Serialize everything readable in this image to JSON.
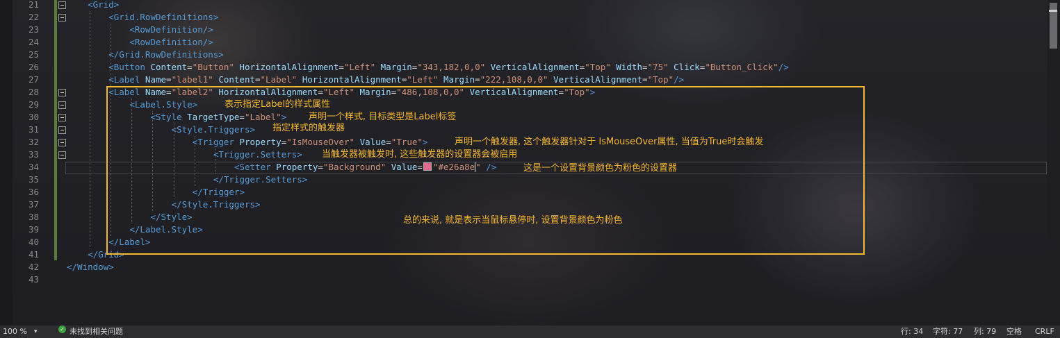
{
  "editor": {
    "lines": [
      {
        "n": "21",
        "segs": [
          [
            "tag",
            "<Grid"
          ],
          [
            "tag",
            ">"
          ]
        ]
      },
      {
        "n": "22",
        "segs": [
          [
            "tag",
            "<Grid.RowDefinitions"
          ],
          [
            "tag",
            ">"
          ]
        ]
      },
      {
        "n": "23",
        "segs": [
          [
            "tag",
            "<RowDefinition"
          ],
          [
            "tag",
            "/>"
          ]
        ]
      },
      {
        "n": "24",
        "segs": [
          [
            "tag",
            "<RowDefinition"
          ],
          [
            "tag",
            "/>"
          ]
        ]
      },
      {
        "n": "25",
        "segs": [
          [
            "tag",
            "</Grid.RowDefinitions"
          ],
          [
            "tag",
            ">"
          ]
        ]
      },
      {
        "n": "26",
        "segs": [
          [
            "tag",
            "<Button"
          ],
          [
            "t",
            " "
          ],
          [
            "attr",
            "Content"
          ],
          [
            "eq",
            "="
          ],
          [
            "str",
            "\"Button\""
          ],
          [
            "t",
            " "
          ],
          [
            "attr",
            "HorizontalAlignment"
          ],
          [
            "eq",
            "="
          ],
          [
            "str",
            "\"Left\""
          ],
          [
            "t",
            " "
          ],
          [
            "attr",
            "Margin"
          ],
          [
            "eq",
            "="
          ],
          [
            "str",
            "\"343,182,0,0\""
          ],
          [
            "t",
            " "
          ],
          [
            "attr",
            "VerticalAlignment"
          ],
          [
            "eq",
            "="
          ],
          [
            "str",
            "\"Top\""
          ],
          [
            "t",
            " "
          ],
          [
            "attr",
            "Width"
          ],
          [
            "eq",
            "="
          ],
          [
            "str",
            "\"75\""
          ],
          [
            "t",
            " "
          ],
          [
            "attr",
            "Click"
          ],
          [
            "eq",
            "="
          ],
          [
            "str",
            "\"Button_Click\""
          ],
          [
            "tag",
            "/>"
          ]
        ]
      },
      {
        "n": "27",
        "segs": [
          [
            "tag",
            "<Label"
          ],
          [
            "t",
            " "
          ],
          [
            "attr",
            "Name"
          ],
          [
            "eq",
            "="
          ],
          [
            "str",
            "\"label1\""
          ],
          [
            "t",
            " "
          ],
          [
            "attr",
            "Content"
          ],
          [
            "eq",
            "="
          ],
          [
            "str",
            "\"Label\""
          ],
          [
            "t",
            " "
          ],
          [
            "attr",
            "HorizontalAlignment"
          ],
          [
            "eq",
            "="
          ],
          [
            "str",
            "\"Left\""
          ],
          [
            "t",
            " "
          ],
          [
            "attr",
            "Margin"
          ],
          [
            "eq",
            "="
          ],
          [
            "str",
            "\"222,108,0,0\""
          ],
          [
            "t",
            " "
          ],
          [
            "attr",
            "VerticalAlignment"
          ],
          [
            "eq",
            "="
          ],
          [
            "str",
            "\"Top\""
          ],
          [
            "tag",
            "/>"
          ]
        ]
      },
      {
        "n": "28",
        "segs": [
          [
            "tag",
            "<Label"
          ],
          [
            "t",
            " "
          ],
          [
            "attr",
            "Name"
          ],
          [
            "eq",
            "="
          ],
          [
            "str",
            "\"label2\""
          ],
          [
            "t",
            " "
          ],
          [
            "attr",
            "HorizontalAlignment"
          ],
          [
            "eq",
            "="
          ],
          [
            "str",
            "\"Left\""
          ],
          [
            "t",
            " "
          ],
          [
            "attr",
            "Margin"
          ],
          [
            "eq",
            "="
          ],
          [
            "str",
            "\"486,108,0,0\""
          ],
          [
            "t",
            " "
          ],
          [
            "attr",
            "VerticalAlignment"
          ],
          [
            "eq",
            "="
          ],
          [
            "str",
            "\"Top\""
          ],
          [
            "tag",
            ">"
          ]
        ]
      },
      {
        "n": "29",
        "segs": [
          [
            "tag",
            "<Label.Style"
          ],
          [
            "tag",
            ">"
          ]
        ]
      },
      {
        "n": "30",
        "segs": [
          [
            "tag",
            "<Style"
          ],
          [
            "t",
            " "
          ],
          [
            "attr",
            "TargetType"
          ],
          [
            "eq",
            "="
          ],
          [
            "str",
            "\"Label\""
          ],
          [
            "tag",
            ">"
          ]
        ]
      },
      {
        "n": "31",
        "segs": [
          [
            "tag",
            "<Style.Triggers"
          ],
          [
            "tag",
            ">"
          ]
        ]
      },
      {
        "n": "32",
        "segs": [
          [
            "tag",
            "<Trigger"
          ],
          [
            "t",
            " "
          ],
          [
            "attr",
            "Property"
          ],
          [
            "eq",
            "="
          ],
          [
            "str",
            "\"IsMouseOver\""
          ],
          [
            "t",
            " "
          ],
          [
            "attr",
            "Value"
          ],
          [
            "eq",
            "="
          ],
          [
            "str",
            "\"True\""
          ],
          [
            "tag",
            ">"
          ]
        ]
      },
      {
        "n": "33",
        "segs": [
          [
            "tag",
            "<Trigger.Setters"
          ],
          [
            "tag",
            ">"
          ]
        ]
      },
      {
        "n": "34",
        "segs": [
          [
            "tag",
            "<Setter"
          ],
          [
            "t",
            " "
          ],
          [
            "attr",
            "Property"
          ],
          [
            "eq",
            "="
          ],
          [
            "str",
            "\"Background\""
          ],
          [
            "t",
            " "
          ],
          [
            "attr",
            "Value"
          ],
          [
            "eq",
            "="
          ],
          [
            "swatch",
            ""
          ],
          [
            "str",
            "\"#e26a8e"
          ],
          [
            "caret",
            ""
          ],
          [
            "str",
            "\""
          ],
          [
            "t",
            " "
          ],
          [
            "tag",
            "/>"
          ]
        ]
      },
      {
        "n": "35",
        "segs": [
          [
            "tag",
            "</Trigger.Setters"
          ],
          [
            "tag",
            ">"
          ]
        ]
      },
      {
        "n": "36",
        "segs": [
          [
            "tag",
            "</Trigger"
          ],
          [
            "tag",
            ">"
          ]
        ]
      },
      {
        "n": "37",
        "segs": [
          [
            "tag",
            "</Style.Triggers"
          ],
          [
            "tag",
            ">"
          ]
        ]
      },
      {
        "n": "38",
        "segs": [
          [
            "tag",
            "</Style"
          ],
          [
            "tag",
            ">"
          ]
        ]
      },
      {
        "n": "39",
        "segs": [
          [
            "tag",
            "</Label.Style"
          ],
          [
            "tag",
            ">"
          ]
        ]
      },
      {
        "n": "40",
        "segs": [
          [
            "tag",
            "</Label"
          ],
          [
            "tag",
            ">"
          ]
        ]
      },
      {
        "n": "41",
        "segs": [
          [
            "tag",
            "</Grid"
          ],
          [
            "tag",
            ">"
          ]
        ]
      },
      {
        "n": "42",
        "segs": [
          [
            "tag",
            "</Window"
          ],
          [
            "tag",
            ">"
          ]
        ]
      },
      {
        "n": "43",
        "segs": []
      }
    ],
    "swatch_color": "#e26a8e"
  },
  "annotations": {
    "a29": "表示指定Label的样式属性",
    "a30": "声明一个样式, 目标类型是Label标签",
    "a31": "指定样式的触发器",
    "a32": "声明一个触发器, 这个触发器针对于 IsMouseOver属性, 当值为True时会触发",
    "a33": "当触发器被触发时, 这些触发器的设置器会被启用",
    "a34": "这是一个设置背景颜色为粉色的设置器",
    "summary": "总的来说, 就是表示当鼠标悬停时, 设置背景颜色为粉色",
    "color": "#f5b82e"
  },
  "status": {
    "zoom": "100 %",
    "issues": "未找到相关问题",
    "line": "行: 34",
    "char": "字符: 77",
    "col": "列: 79",
    "spaces": "空格",
    "eol": "CRLF"
  }
}
